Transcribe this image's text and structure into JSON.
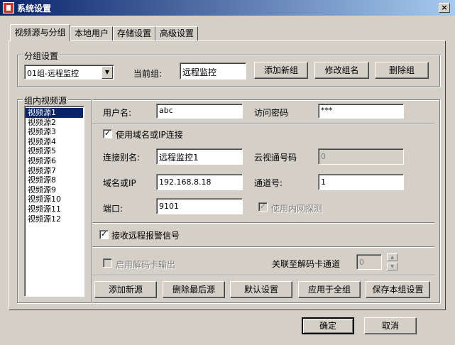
{
  "window": {
    "title": "系统设置",
    "close_glyph": "×"
  },
  "tabs": [
    {
      "label": "视频源与分组"
    },
    {
      "label": "本地用户"
    },
    {
      "label": "存储设置"
    },
    {
      "label": "高级设置"
    }
  ],
  "group_settings": {
    "legend": "分组设置",
    "selected_group": "01组-远程监控",
    "current_group_label": "当前组:",
    "current_group_value": "远程监控",
    "add_label": "添加新组",
    "rename_label": "修改组名",
    "delete_label": "删除组"
  },
  "sources": {
    "legend": "组内视频源",
    "items": [
      "视频源1",
      "视频源2",
      "视频源3",
      "视频源4",
      "视频源5",
      "视频源6",
      "视频源7",
      "视频源8",
      "视频源9",
      "视频源10",
      "视频源11",
      "视频源12"
    ],
    "selected_index": 0
  },
  "form": {
    "username_label": "用户名:",
    "username_value": "abc",
    "password_label": "访问密码",
    "password_value": "***",
    "use_domain_label": "使用域名或IP连接",
    "alias_label": "连接别名:",
    "alias_value": "远程监控1",
    "cloud_label": "云视通号码",
    "cloud_value": "0",
    "domain_label": "域名或IP",
    "domain_value": "192.168.8.18",
    "channel_label": "通道号:",
    "channel_value": "1",
    "port_label": "端口:",
    "port_value": "9101",
    "lan_probe_label": "使用内网探测",
    "alarm_label": "接收远程报警信号",
    "decoder_label": "启用解码卡输出",
    "decoder_channel_label": "关联至解码卡通道",
    "decoder_channel_value": "0"
  },
  "source_actions": {
    "add": "添加新源",
    "delete_last": "删除最后源",
    "default": "默认设置",
    "apply_all": "应用于全组",
    "save_group": "保存本组设置"
  },
  "dialog": {
    "ok": "确定",
    "cancel": "取消"
  },
  "glyphs": {
    "check": "✓",
    "down": "▼",
    "up": "▲"
  }
}
